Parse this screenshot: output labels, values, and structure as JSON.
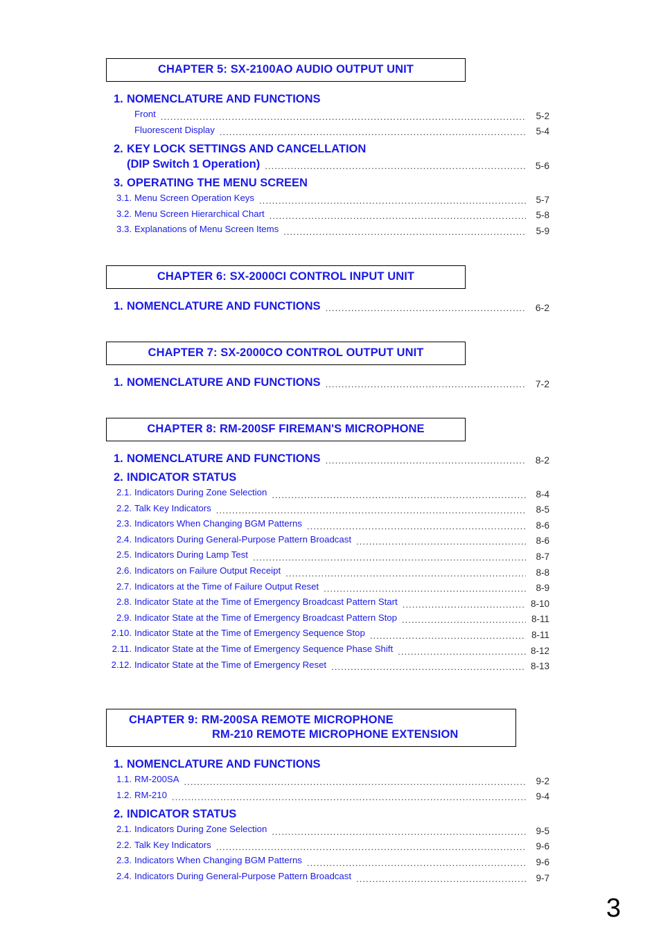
{
  "page": {
    "number": "3",
    "accent_color": "#1a1ae6",
    "text_color": "#000000",
    "background": "#ffffff"
  },
  "chapters": [
    {
      "banner": {
        "lines": [
          "CHAPTER 5: SX-2100AO AUDIO OUTPUT UNIT"
        ]
      },
      "sections": [
        {
          "number": "1.",
          "title": "NOMENCLATURE AND FUNCTIONS",
          "page": "",
          "entries": [
            {
              "number": "",
              "title": "Front",
              "page": "5-2"
            },
            {
              "number": "",
              "title": "Fluorescent Display",
              "page": "5-4"
            }
          ]
        },
        {
          "number": "2.",
          "title": "KEY LOCK SETTINGS AND CANCELLATION",
          "title_line2": "(DIP Switch 1 Operation)",
          "page": "5-6",
          "entries": []
        },
        {
          "number": "3.",
          "title": "OPERATING THE MENU SCREEN",
          "page": "",
          "entries": [
            {
              "number": "3.1.",
              "title": "Menu Screen Operation Keys",
              "page": "5-7"
            },
            {
              "number": "3.2.",
              "title": "Menu Screen Hierarchical Chart",
              "page": "5-8"
            },
            {
              "number": "3.3.",
              "title": "Explanations of Menu Screen Items",
              "page": "5-9"
            }
          ]
        }
      ]
    },
    {
      "banner": {
        "lines": [
          "CHAPTER 6: SX-2000CI CONTROL INPUT UNIT"
        ]
      },
      "sections": [
        {
          "number": "1.",
          "title": "NOMENCLATURE AND FUNCTIONS",
          "page": "6-2",
          "entries": []
        }
      ]
    },
    {
      "banner": {
        "lines": [
          "CHAPTER 7: SX-2000CO CONTROL OUTPUT UNIT"
        ]
      },
      "sections": [
        {
          "number": "1.",
          "title": "NOMENCLATURE AND FUNCTIONS",
          "page": "7-2",
          "entries": []
        }
      ]
    },
    {
      "banner": {
        "lines": [
          "CHAPTER 8: RM-200SF FIREMAN'S MICROPHONE"
        ]
      },
      "sections": [
        {
          "number": "1.",
          "title": "NOMENCLATURE AND FUNCTIONS",
          "page": "8-2",
          "entries": []
        },
        {
          "number": "2.",
          "title": "INDICATOR STATUS",
          "page": "",
          "entries": [
            {
              "number": "2.1.",
              "title": "Indicators During Zone Selection",
              "page": "8-4"
            },
            {
              "number": "2.2.",
              "title": "Talk Key Indicators",
              "page": "8-5"
            },
            {
              "number": "2.3.",
              "title": "Indicators When Changing BGM Patterns",
              "page": "8-6"
            },
            {
              "number": "2.4.",
              "title": "Indicators During General-Purpose Pattern Broadcast",
              "page": "8-6"
            },
            {
              "number": "2.5.",
              "title": "Indicators During Lamp Test",
              "page": "8-7"
            },
            {
              "number": "2.6.",
              "title": "Indicators on Failure Output Receipt",
              "page": "8-8"
            },
            {
              "number": "2.7.",
              "title": "Indicators at the Time of Failure Output Reset",
              "page": "8-9"
            },
            {
              "number": "2.8.",
              "title": "Indicator State at the Time of Emergency Broadcast Pattern Start",
              "page": "8-10"
            },
            {
              "number": "2.9.",
              "title": "Indicator State at the Time of Emergency Broadcast Pattern Stop",
              "page": "8-11"
            },
            {
              "number": "2.10.",
              "title": "Indicator State at the Time of Emergency Sequence Stop",
              "page": "8-11"
            },
            {
              "number": "2.11.",
              "title": "Indicator State at the Time of Emergency Sequence Phase Shift",
              "page": "8-12"
            },
            {
              "number": "2.12.",
              "title": "Indicator State at the Time of Emergency Reset",
              "page": "8-13"
            }
          ]
        }
      ]
    },
    {
      "banner": {
        "lines": [
          "CHAPTER 9: RM-200SA REMOTE MICROPHONE",
          "RM-210 REMOTE MICROPHONE EXTENSION"
        ],
        "wide": true
      },
      "sections": [
        {
          "number": "1.",
          "title": "NOMENCLATURE AND FUNCTIONS",
          "page": "",
          "entries": [
            {
              "number": "1.1.",
              "title": "RM-200SA",
              "page": "9-2"
            },
            {
              "number": "1.2.",
              "title": "RM-210",
              "page": "9-4"
            }
          ]
        },
        {
          "number": "2.",
          "title": "INDICATOR STATUS",
          "page": "",
          "entries": [
            {
              "number": "2.1.",
              "title": "Indicators During Zone Selection",
              "page": "9-5"
            },
            {
              "number": "2.2.",
              "title": "Talk Key Indicators",
              "page": "9-6"
            },
            {
              "number": "2.3.",
              "title": "Indicators When Changing BGM Patterns",
              "page": "9-6"
            },
            {
              "number": "2.4.",
              "title": "Indicators During General-Purpose Pattern Broadcast",
              "page": "9-7"
            }
          ]
        }
      ]
    }
  ]
}
